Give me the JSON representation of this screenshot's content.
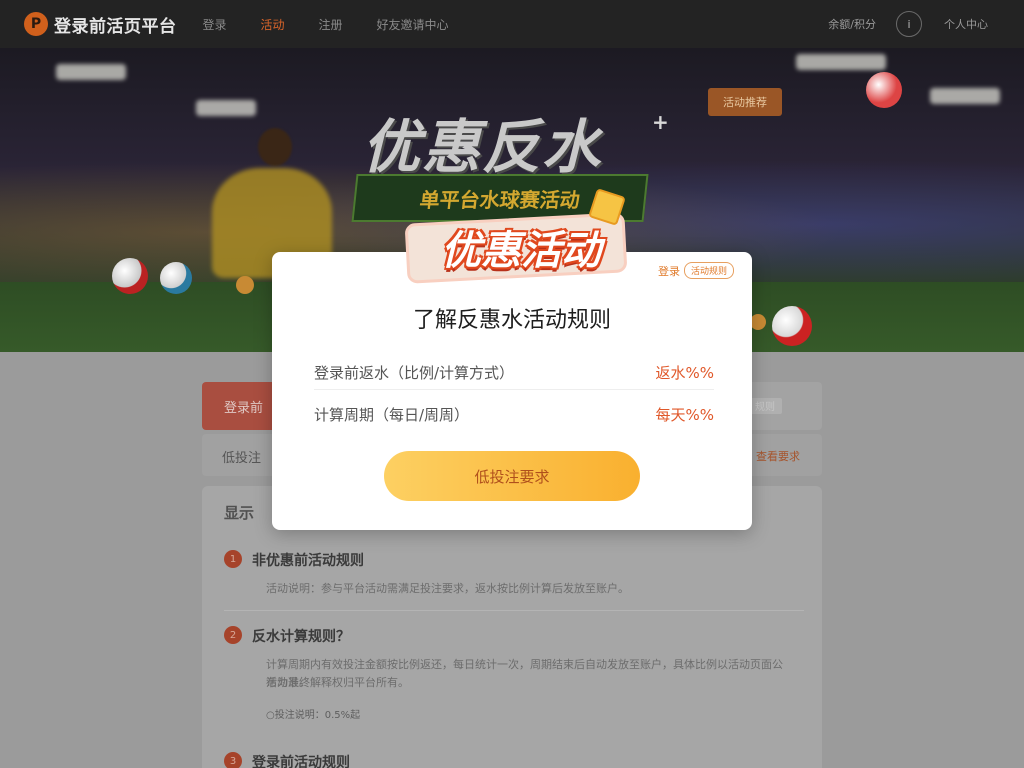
{
  "nav": {
    "logo_glyph": "P",
    "brand": "登录前活页平台",
    "links": [
      "登录",
      "活动",
      "注册",
      "好友邀请中心"
    ],
    "balance": "余额/积分",
    "avatar_glyph": "i",
    "user": "个人中心"
  },
  "hero": {
    "title": "优惠反水",
    "title_mark": "+",
    "subtitle": "单平台水球赛活动",
    "tag": "活动推荐"
  },
  "page": {
    "tab_active": "登录前",
    "tab_right": "规则",
    "row_left": "低投注",
    "row_right": "查看要求",
    "card_head": "显示",
    "rules": [
      {
        "icon": "1",
        "title": "非优惠前活动规则",
        "desc": "活动说明：参与平台活动需满足投注要求，返水按比例计算后发放至账户。"
      },
      {
        "icon": "2",
        "title": "反水计算规则？",
        "desc": "计算周期内有效投注金额按比例返还，每日统计一次，周期结束后自动发放至账户，具体比例以活动页面公布为准。",
        "desc2": "活动最终解释权归平台所有。",
        "note": "○投注说明：0.5%起"
      },
      {
        "icon": "3",
        "title": "登录前活动规则"
      }
    ]
  },
  "modal": {
    "badge": "优惠活动",
    "link_text": "登录",
    "link_pill": "活动规则",
    "title": "了解反惠水活动规则",
    "rows": [
      {
        "label": "登录前返水（比例/计算方式）",
        "value": "返水%%"
      },
      {
        "label": "计算周期（每日/周周）",
        "value": "每天%%"
      }
    ],
    "button": "低投注要求"
  },
  "colors": {
    "accent": "#e0582a",
    "button": "#f9b02f",
    "nav_active": "#d8642a"
  }
}
